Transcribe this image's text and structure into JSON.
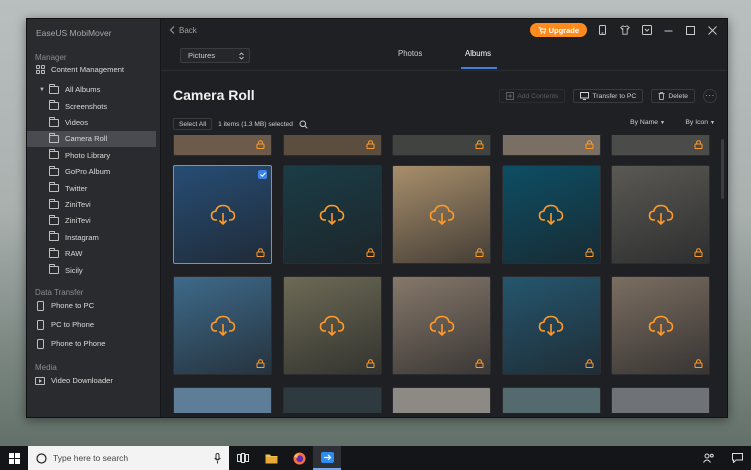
{
  "app": {
    "title": "EaseUS MobiMover",
    "back": "Back",
    "upgrade": "Upgrade"
  },
  "sidebar": {
    "manager_label": "Manager",
    "content_management": "Content Management",
    "all_albums": "All Albums",
    "albums": [
      "Screenshots",
      "Videos",
      "Camera Roll",
      "Photo Library",
      "GoPro Album",
      "Twitter",
      "ZiniTevi",
      "ZiniTevi",
      "Instagram",
      "RAW",
      "Sicily"
    ],
    "active_album": "Camera Roll",
    "data_transfer_label": "Data Transfer",
    "transfer": [
      "Phone to PC",
      "PC to Phone",
      "Phone to Phone"
    ],
    "media_label": "Media",
    "media": [
      "Video Downloader"
    ]
  },
  "main": {
    "category_select": "Pictures",
    "tabs": [
      "Photos",
      "Albums"
    ],
    "active_tab": "Albums",
    "title": "Camera Roll",
    "add_contents": "Add Contents",
    "transfer_to_pc": "Transfer to PC",
    "delete": "Delete",
    "select_all": "Select All",
    "selection_info": "1 items (1.3 MB) selected",
    "sort_by": "By Name",
    "view_by": "By Icon"
  },
  "photos": [
    {
      "bg": "#274d74",
      "selected": true
    },
    {
      "bg": "#1b3c46",
      "selected": false
    },
    {
      "bg": "#a88f6c",
      "selected": false
    },
    {
      "bg": "#0d4e64",
      "selected": false
    },
    {
      "bg": "#5a5954",
      "selected": false
    },
    {
      "bg": "#3e6a8a",
      "selected": false
    },
    {
      "bg": "#6d6a55",
      "selected": false
    },
    {
      "bg": "#86786a",
      "selected": false
    },
    {
      "bg": "#25566e",
      "selected": false
    },
    {
      "bg": "#7b6e61",
      "selected": false
    }
  ],
  "taskbar": {
    "search_placeholder": "Type here to search"
  },
  "colors": {
    "accent": "#3f7fe0",
    "upgrade": "#ff8b1f",
    "cloud": "#ff9a2a"
  }
}
